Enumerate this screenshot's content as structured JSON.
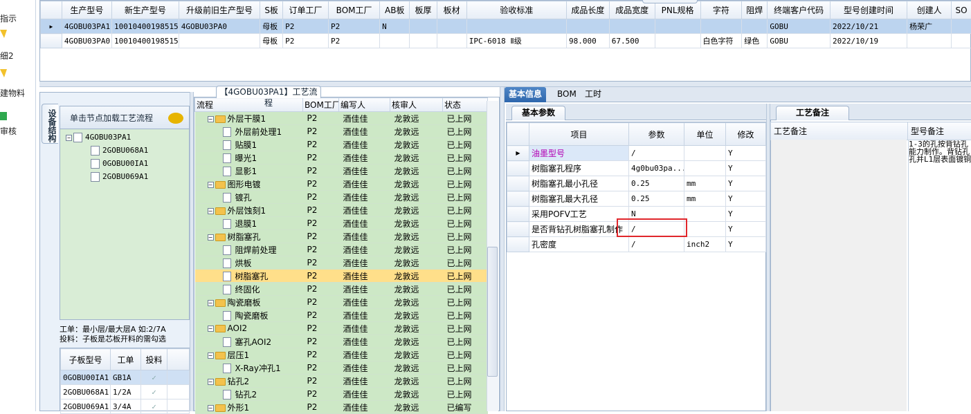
{
  "nav": {
    "items": [
      "指示",
      "细2",
      "建物料",
      "审核"
    ]
  },
  "top_grid": {
    "columns": [
      "生产型号",
      "新生产型号",
      "升级前旧生产型号",
      "S板",
      "订单工厂",
      "BOM工厂",
      "AB板",
      "板厚",
      "板材",
      "验收标准",
      "成品长度",
      "成品宽度",
      "PNL规格",
      "字符",
      "阻焊",
      "终端客户代码",
      "型号创建时间",
      "创建人",
      "SO"
    ],
    "rows": [
      [
        "4GOBU03PA1",
        "10010400198515",
        "4GOBU03PA0",
        "母板",
        "P2",
        "P2",
        "N",
        "",
        "",
        "",
        "",
        "",
        "",
        "",
        "",
        "GOBU",
        "2022/10/21",
        "杨荣广",
        ""
      ],
      [
        "4GOBU03PA0",
        "10010400198515",
        "",
        "母板",
        "P2",
        "P2",
        "",
        "",
        "",
        "IPC-6018 Ⅱ级",
        "98.000",
        "67.500",
        "",
        "白色字符",
        "绿色",
        "GOBU",
        "2022/10/19",
        "",
        ""
      ]
    ]
  },
  "left_panel": {
    "side_tab": "设备结构",
    "tree_header": "单击节点加载工艺流程",
    "tree": {
      "root": "4GOBU03PA1",
      "children": [
        "2GOBU068A1",
        "0GOBU00IA1",
        "2GOBU069A1"
      ]
    },
    "notes": [
      "工单：最小层/最大层A 如:2/7A",
      "投料：子板是芯板开料的需勾选"
    ],
    "sub_table": {
      "columns": [
        "子板型号",
        "工单",
        "投料"
      ],
      "rows": [
        [
          "0GOBU00IA1",
          "GB1A",
          "✓"
        ],
        [
          "2GOBU068A1",
          "1/2A",
          "✓"
        ],
        [
          "2GOBU069A1",
          "3/4A",
          "✓"
        ]
      ]
    }
  },
  "flow": {
    "title": "【4GOBU03PA1】工艺流程",
    "columns": [
      "流程",
      "BOM工厂",
      "编写人",
      "核审人",
      "状态"
    ],
    "rows": [
      {
        "name": "外层干膜1",
        "type": "folder",
        "bom": "P2",
        "writer": "酒佳佳",
        "reviewer": "龙敦远",
        "status": "已上网"
      },
      {
        "name": "外层前处理1",
        "type": "doc",
        "bom": "P2",
        "writer": "酒佳佳",
        "reviewer": "龙敦远",
        "status": "已上网"
      },
      {
        "name": "贴膜1",
        "type": "doc",
        "bom": "P2",
        "writer": "酒佳佳",
        "reviewer": "龙敦远",
        "status": "已上网"
      },
      {
        "name": "曝光1",
        "type": "doc",
        "bom": "P2",
        "writer": "酒佳佳",
        "reviewer": "龙敦远",
        "status": "已上网"
      },
      {
        "name": "显影1",
        "type": "doc",
        "bom": "P2",
        "writer": "酒佳佳",
        "reviewer": "龙敦远",
        "status": "已上网"
      },
      {
        "name": "图形电镀",
        "type": "folder",
        "bom": "P2",
        "writer": "酒佳佳",
        "reviewer": "龙敦远",
        "status": "已上网"
      },
      {
        "name": "镀孔",
        "type": "doc",
        "bom": "P2",
        "writer": "酒佳佳",
        "reviewer": "龙敦远",
        "status": "已上网"
      },
      {
        "name": "外层蚀刻1",
        "type": "folder",
        "bom": "P2",
        "writer": "酒佳佳",
        "reviewer": "龙敦远",
        "status": "已上网"
      },
      {
        "name": "退膜1",
        "type": "doc",
        "bom": "P2",
        "writer": "酒佳佳",
        "reviewer": "龙敦远",
        "status": "已上网"
      },
      {
        "name": "树脂塞孔",
        "type": "folder",
        "bom": "P2",
        "writer": "酒佳佳",
        "reviewer": "龙敦远",
        "status": "已上网"
      },
      {
        "name": "阻焊前处理",
        "type": "doc",
        "bom": "P2",
        "writer": "酒佳佳",
        "reviewer": "龙敦远",
        "status": "已上网"
      },
      {
        "name": "烘板",
        "type": "doc",
        "bom": "P2",
        "writer": "酒佳佳",
        "reviewer": "龙敦远",
        "status": "已上网"
      },
      {
        "name": "树脂塞孔",
        "type": "doc",
        "bom": "P2",
        "writer": "酒佳佳",
        "reviewer": "龙敦远",
        "status": "已上网",
        "selected": true
      },
      {
        "name": "终固化",
        "type": "doc",
        "bom": "P2",
        "writer": "酒佳佳",
        "reviewer": "龙敦远",
        "status": "已上网"
      },
      {
        "name": "陶瓷磨板",
        "type": "folder",
        "bom": "P2",
        "writer": "酒佳佳",
        "reviewer": "龙敦远",
        "status": "已上网"
      },
      {
        "name": "陶瓷磨板",
        "type": "doc",
        "bom": "P2",
        "writer": "酒佳佳",
        "reviewer": "龙敦远",
        "status": "已上网"
      },
      {
        "name": "AOI2",
        "type": "folder",
        "bom": "P2",
        "writer": "酒佳佳",
        "reviewer": "龙敦远",
        "status": "已上网"
      },
      {
        "name": "塞孔AOI2",
        "type": "doc",
        "bom": "P2",
        "writer": "酒佳佳",
        "reviewer": "龙敦远",
        "status": "已上网"
      },
      {
        "name": "层压1",
        "type": "folder",
        "bom": "P2",
        "writer": "酒佳佳",
        "reviewer": "龙敦远",
        "status": "已上网"
      },
      {
        "name": "X-Ray冲孔1",
        "type": "doc",
        "bom": "P2",
        "writer": "酒佳佳",
        "reviewer": "龙敦远",
        "status": "已上网"
      },
      {
        "name": "钻孔2",
        "type": "folder",
        "bom": "P2",
        "writer": "酒佳佳",
        "reviewer": "龙敦远",
        "status": "已上网"
      },
      {
        "name": "钻孔2",
        "type": "doc",
        "bom": "P2",
        "writer": "酒佳佳",
        "reviewer": "龙敦远",
        "status": "已上网"
      },
      {
        "name": "外形1",
        "type": "folder",
        "bom": "P2",
        "writer": "酒佳佳",
        "reviewer": "龙敦远",
        "status": "已编写"
      }
    ]
  },
  "right_tabs": [
    "基本信息",
    "BOM",
    "工时"
  ],
  "basic_params": {
    "tab": "基本参数",
    "columns": [
      "项目",
      "参数",
      "单位",
      "修改"
    ],
    "rows": [
      [
        "油墨型号",
        "/",
        "",
        "Y"
      ],
      [
        "树脂塞孔程序",
        "4g0bu03pa...",
        "",
        "Y"
      ],
      [
        "树脂塞孔最小孔径",
        "0.25",
        "mm",
        "Y"
      ],
      [
        "树脂塞孔最大孔径",
        "0.25",
        "mm",
        "Y"
      ],
      [
        "采用POFV工艺",
        "N",
        "",
        "Y"
      ],
      [
        "是否背钻孔树脂塞孔制作",
        "/",
        "",
        "Y"
      ],
      [
        "孔密度",
        "/",
        "inch2",
        "Y"
      ]
    ]
  },
  "craft_notes": {
    "tab": "工艺备注",
    "columns": [
      "工艺备注",
      "型号备注"
    ],
    "model_note": "1-3的孔按背钻孔\n能力制作。背钻孔\n孔并L1层表面镀铜"
  },
  "colors": {
    "accent": "#2e67ad",
    "tree_bg": "#cde8c6",
    "selected_row": "#ffdf8a",
    "highlight_box": "#e0262b"
  }
}
